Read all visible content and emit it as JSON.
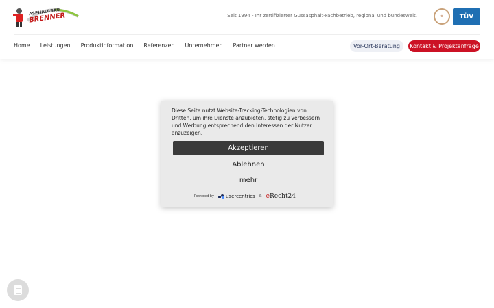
{
  "header": {
    "logo_text_top": "ASPHALT-BAU",
    "logo_text_main": "BRENNER",
    "tagline": "Seit 1994 - Ihr zertifizierter Gussasphalt-Fachbetrieb, regional und bundesweit.",
    "cert_tuv_label": "TÜV"
  },
  "nav": {
    "items": [
      {
        "label": "Home"
      },
      {
        "label": "Leistungen"
      },
      {
        "label": "Produktinformation"
      },
      {
        "label": "Referenzen"
      },
      {
        "label": "Unternehmen"
      },
      {
        "label": "Partner werden"
      }
    ],
    "consult_label": "Vor-Ort-Beratung",
    "contact_label": "Kontakt & Projektanfrage"
  },
  "consent": {
    "text": "Diese Seite nutzt Website-Tracking-Technologien von Dritten, um ihre Dienste anzubieten, stetig zu verbessern und Werbung entsprechend den Interessen der Nutzer anzuzeigen.",
    "accept_label": "Akzeptieren",
    "decline_label": "Ablehnen",
    "more_label": "mehr",
    "powered_by": "Powered by",
    "usercentrics": "usercentrics",
    "ampersand": "&",
    "erecht_prefix": "e",
    "erecht_name": "Recht24"
  },
  "colors": {
    "accent_red": "#cc1225",
    "accept_bg": "#3a3a3a",
    "modal_bg": "#eaeaea"
  },
  "icons": {
    "chat": "chat-icon",
    "logo": "worker-logo"
  }
}
